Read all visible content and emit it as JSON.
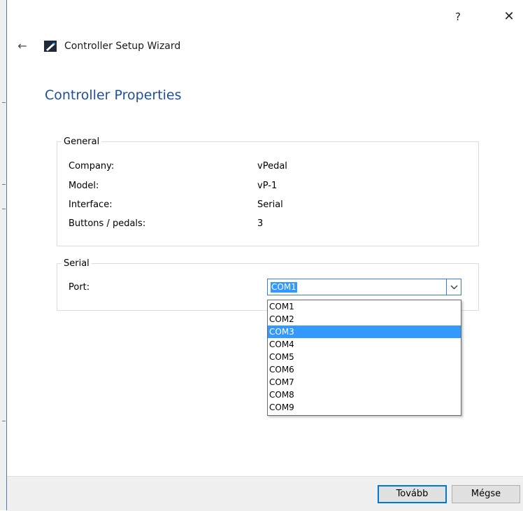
{
  "titlebar": {
    "help_label": "?",
    "close_label": "✕"
  },
  "header": {
    "back_label": "←",
    "app_title": "Controller Setup Wizard"
  },
  "page": {
    "title": "Controller Properties"
  },
  "general": {
    "legend": "General",
    "rows": [
      {
        "label": "Company:",
        "value": "vPedal"
      },
      {
        "label": "Model:",
        "value": "vP-1"
      },
      {
        "label": "Interface:",
        "value": "Serial"
      },
      {
        "label": "Buttons / pedals:",
        "value": "3"
      }
    ]
  },
  "serial": {
    "legend": "Serial",
    "port_label": "Port:",
    "selected_port": "COM1",
    "highlighted_option": "COM3",
    "options": [
      "COM1",
      "COM2",
      "COM3",
      "COM4",
      "COM5",
      "COM6",
      "COM7",
      "COM8",
      "COM9"
    ]
  },
  "footer": {
    "next_label": "Tovább",
    "cancel_label": "Mégse"
  },
  "colors": {
    "accent": "#0078d7",
    "title_blue": "#1f4e99",
    "selection": "#3399ff"
  }
}
